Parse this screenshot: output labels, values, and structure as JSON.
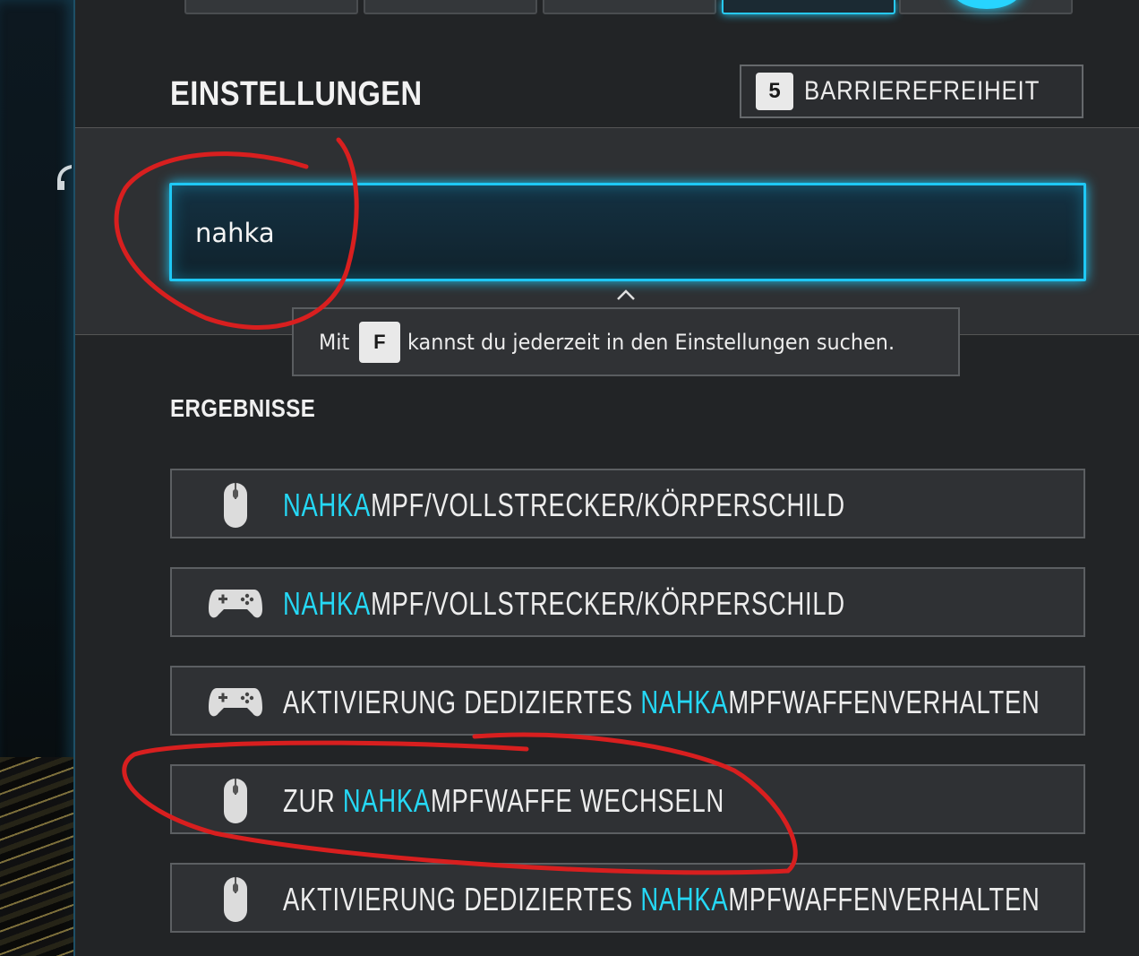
{
  "header": {
    "title": "EINSTELLUNGEN",
    "accessibility": {
      "key": "5",
      "label": "BARRIEREFREIHEIT"
    }
  },
  "search": {
    "value": "nahka",
    "tooltip": {
      "before": "Mit",
      "key": "F",
      "after": "kannst du jederzeit in den Einstellungen suchen."
    }
  },
  "results": {
    "title": "ERGEBNISSE",
    "items": [
      {
        "icon": "mouse-icon",
        "before": "",
        "match": "NAHKA",
        "after": "MPF/VOLLSTRECKER/KÖRPERSCHILD"
      },
      {
        "icon": "controller-icon",
        "before": "",
        "match": "NAHKA",
        "after": "MPF/VOLLSTRECKER/KÖRPERSCHILD"
      },
      {
        "icon": "controller-icon",
        "before": "AKTIVIERUNG DEDIZIERTES ",
        "match": "NAHKA",
        "after": "MPFWAFFENVERHALTEN"
      },
      {
        "icon": "mouse-icon",
        "before": "ZUR ",
        "match": "NAHKA",
        "after": "MPFWAFFE WECHSELN"
      },
      {
        "icon": "mouse-icon",
        "before": "AKTIVIERUNG DEDIZIERTES ",
        "match": "NAHKA",
        "after": "MPFWAFFENVERHALTEN"
      }
    ]
  },
  "colors": {
    "accent": "#1ec8f5",
    "highlight": "#25d8f5",
    "annotation": "#d81f1f"
  }
}
